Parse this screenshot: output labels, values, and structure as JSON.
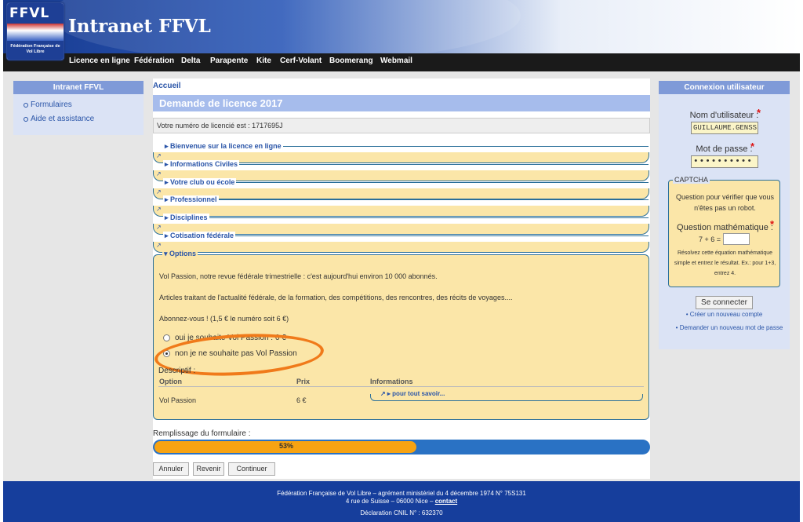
{
  "header": {
    "title": "Intranet FFVL",
    "logo_text": "FFVL",
    "logo_sub": "Fédération Française de Vol Libre"
  },
  "nav": [
    "Licence en ligne",
    "Fédération",
    "Delta",
    "Parapente",
    "Kite",
    "Cerf-Volant",
    "Boomerang",
    "Webmail"
  ],
  "left_sidebar": {
    "title": "Intranet FFVL",
    "items": [
      "Formulaires",
      "Aide et assistance"
    ]
  },
  "main": {
    "breadcrumb": "Accueil",
    "page_title": "Demande de licence 2017",
    "licence_number_text": "Votre numéro de licencié est : 1717695J",
    "sections": [
      "Bienvenue sur la licence en ligne",
      "Informations Civiles",
      "Votre club ou école",
      "Professionnel",
      "Disciplines",
      "Cotisation fédérale"
    ],
    "options": {
      "legend": "Options",
      "intro": "Vol Passion, notre revue fédérale trimestrielle : c'est aujourd'hui environ 10 000 abonnés.",
      "articles": "Articles traitant de l'actualité fédérale, de la formation, des compétitions, des rencontres, des récits de voyages....",
      "subscribe": "Abonnez-vous ! (1,5 € le numéro soit 6 €)",
      "radio_yes": "oui je souhaite Vol Passion : 6 €",
      "radio_no": "non je ne souhaite pas Vol Passion",
      "selected": "radio_no",
      "descriptif": "Descriptif :",
      "table_headers": [
        "Option",
        "Prix",
        "Informations"
      ],
      "table_row": {
        "option": "Vol Passion",
        "prix": "6 €",
        "info": "pour tout savoir..."
      }
    },
    "fill_label": "Remplissage du formulaire :",
    "progress_percent": 53,
    "progress_text": "53%",
    "buttons": {
      "cancel": "Annuler",
      "back": "Revenir",
      "continue": "Continuer"
    }
  },
  "right_sidebar": {
    "title": "Connexion utilisateur",
    "username_label": "Nom d'utilisateur :",
    "username_value": "GUILLAUME.GENSS",
    "password_label": "Mot de passe :",
    "password_value": "••••••••••",
    "captcha_legend": "CAPTCHA",
    "captcha_intro": "Question pour vérifier que vous n'êtes pas un robot.",
    "math_label": "Question mathématique :",
    "math_question": "7 + 6 =",
    "math_help": "Résolvez cette équation mathématique simple et entrez le résultat. Ex.: pour 1+3, entrez 4.",
    "login_button": "Se connecter",
    "links": [
      "Créer un nouveau compte",
      "Demander un nouveau mot de passe"
    ]
  },
  "footer": {
    "line1": "Fédération Française de Vol Libre – agrément ministériel du 4 décembre 1974 N° 75S131",
    "line2": "4 rue de Suisse – 06000 Nice –",
    "contact": "contact",
    "line3": "Déclaration CNIL N° : 632370"
  },
  "colors": {
    "accent_orange": "#f07a1a",
    "header_blue": "#163e9c",
    "section_yellow": "#fbe6a8",
    "progress_orange": "#f7a312",
    "progress_blue": "#2a72c4"
  }
}
